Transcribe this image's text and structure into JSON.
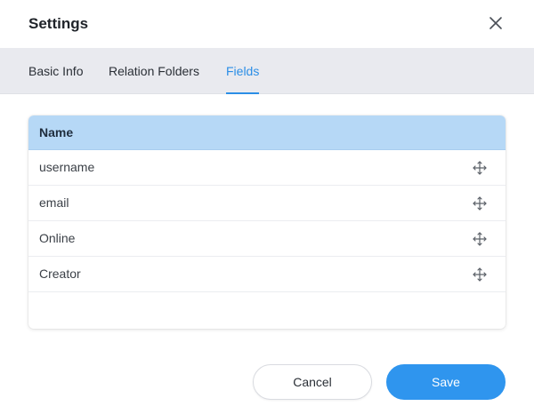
{
  "dialog": {
    "title": "Settings",
    "close_icon": "close-icon"
  },
  "tabs": [
    {
      "label": "Basic Info",
      "active": false
    },
    {
      "label": "Relation Folders",
      "active": false
    },
    {
      "label": "Fields",
      "active": true
    }
  ],
  "fields_table": {
    "column_header": "Name",
    "rows": [
      {
        "name": "username",
        "icon": "drag-move-icon"
      },
      {
        "name": "email",
        "icon": "drag-move-icon"
      },
      {
        "name": "Online",
        "icon": "drag-move-icon"
      },
      {
        "name": "Creator",
        "icon": "drag-move-icon"
      }
    ]
  },
  "footer": {
    "cancel_label": "Cancel",
    "save_label": "Save"
  },
  "colors": {
    "accent": "#2f95ee",
    "header_row": "#b6d8f6",
    "tab_bar": "#e9eaef"
  }
}
